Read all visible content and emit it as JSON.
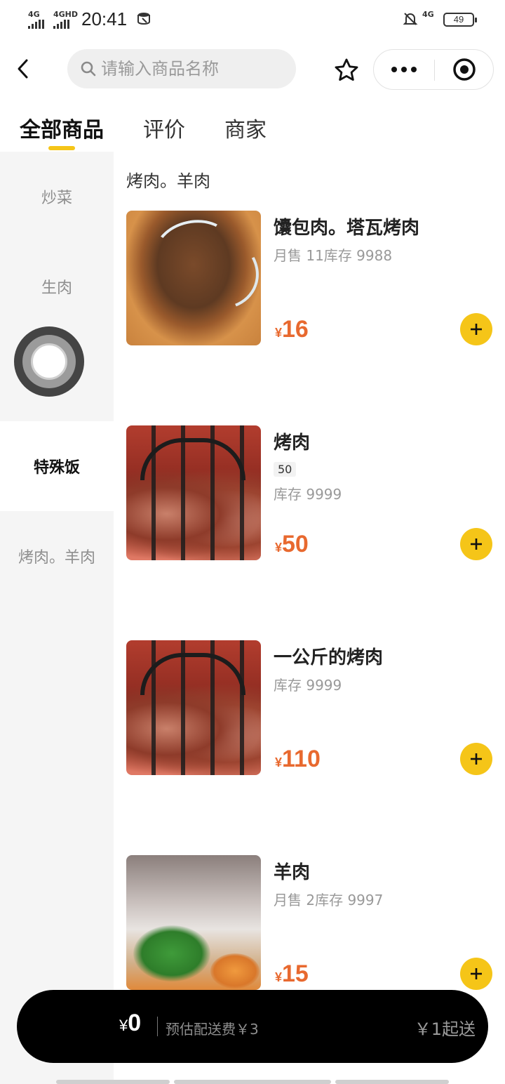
{
  "status_bar": {
    "signal1_label": "4G",
    "signal2_label": "4GHD",
    "time": "20:41",
    "network_label": "4G",
    "battery_level": "49"
  },
  "header": {
    "search_placeholder": "请输入商品名称",
    "icons": [
      "back-arrow-icon",
      "search-icon",
      "star-icon",
      "more-dots-icon",
      "target-icon"
    ]
  },
  "tabs": [
    {
      "label": "全部商品",
      "active": true
    },
    {
      "label": "评价",
      "active": false
    },
    {
      "label": "商家",
      "active": false
    }
  ],
  "sidebar": {
    "items": [
      {
        "label": "炒菜"
      },
      {
        "label": "生肉"
      },
      {
        "label": ""
      },
      {
        "label": "特殊饭",
        "active": true
      },
      {
        "label": "烤肉。羊肉"
      }
    ]
  },
  "section_title": "烤肉。羊肉",
  "products": [
    {
      "name": "馕包肉。塔瓦烤肉",
      "sales_stock": "月售 11库存 9988",
      "currency": "¥",
      "price": "16"
    },
    {
      "name": "烤肉",
      "tag": "50",
      "stock": "库存 9999",
      "currency": "¥",
      "price": "50"
    },
    {
      "name": "一公斤的烤肉",
      "stock": "库存 9999",
      "currency": "¥",
      "price": "110"
    },
    {
      "name": "羊肉",
      "sales_stock": "月售 2库存 9997",
      "currency": "¥",
      "price": "15"
    }
  ],
  "cart": {
    "currency": "¥",
    "total": "0",
    "delivery_fee_text": "预估配送费￥3",
    "minimum_text": "￥1起送"
  },
  "colors": {
    "accent": "#f5c518",
    "price": "#e8692f",
    "cart_bg": "#000000",
    "sidebar_bg": "#f5f5f5"
  }
}
